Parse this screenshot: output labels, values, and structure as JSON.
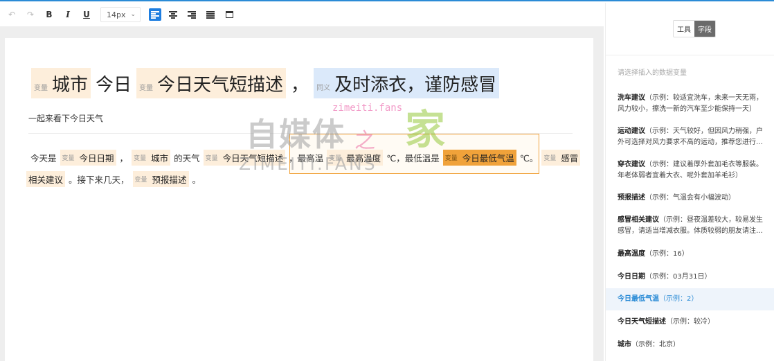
{
  "toolbar": {
    "undo_icon": "undo-icon",
    "redo_icon": "redo-icon",
    "bold": "B",
    "italic": "I",
    "underline": "U",
    "font_size": "14px",
    "align_icons": [
      "align-left-icon",
      "align-center-icon",
      "align-right-icon",
      "align-justify-icon",
      "table-icon"
    ],
    "active_color": "#1e7ee0"
  },
  "editor": {
    "title": {
      "chip1_tag": "变量",
      "chip1_text": "城市",
      "plain1": "今日",
      "chip2_tag": "变量",
      "chip2_text": "今日天气短描述",
      "sep": "，",
      "chip3_tag": "同义",
      "chip3_text": "及时添衣，谨防感冒"
    },
    "subtitle": "一起来看下今日天气",
    "line1": {
      "t1": "今天是",
      "c1_tag": "变量",
      "c1_text": "今日日期",
      "t2": "，",
      "c2_tag": "变量",
      "c2_text": "城市",
      "t3": "的天气",
      "c3_tag": "变量",
      "c3_text": "今日天气短描述",
      "t4": "，最高温",
      "c4_tag": "变量",
      "c4_text": "最高温度",
      "t5": "℃，最低温是",
      "c5_tag": "变量",
      "c5_text": "今日最低气温",
      "t6": "℃。",
      "c6_tag": "变量",
      "c6_text": "感冒"
    },
    "line2": {
      "c1_text": "相关建议",
      "t1": "。接下来几天，",
      "c2_tag": "变量",
      "c2_text": "预报描述",
      "t2": "。"
    }
  },
  "watermark": {
    "url": "zimeiti.fans",
    "cn": "自媒体",
    "jia": "家",
    "en": "ZIMEITI.FANS",
    "swoosh": "之"
  },
  "panel": {
    "tabs": [
      "工具",
      "字段"
    ],
    "active_tab": "字段",
    "hint": "请选择插入的数据变量",
    "fields": [
      {
        "name": "洗车建议",
        "example": "（示例：较适宜洗车，未来一天无雨，风力较小，擦洗一新的汽车至少能保持一天）"
      },
      {
        "name": "运动建议",
        "example": "（示例：天气较好，但因风力稍强，户外可选择对风力要求不高的运动，推荐您进行…"
      },
      {
        "name": "穿衣建议",
        "example": "（示例：建议着厚外套加毛衣等服装。年老体弱者宜着大衣、呢外套加羊毛衫）"
      },
      {
        "name": "预报描述",
        "example": "（示例：气温会有小幅波动）"
      },
      {
        "name": "感冒相关建议",
        "example": "（示例：昼夜温差较大，较易发生感冒，请适当增减衣服。体质较弱的朋友请注…"
      },
      {
        "name": "最高温度",
        "example": "（示例：16）"
      },
      {
        "name": "今日日期",
        "example": "（示例：03月31日）"
      },
      {
        "name": "今日最低气温",
        "example": "（示例：2）"
      },
      {
        "name": "今日天气短描述",
        "example": "（示例：较冷）"
      },
      {
        "name": "城市",
        "example": "（示例：北京）"
      }
    ],
    "selected_color": "#2a8bd6"
  }
}
